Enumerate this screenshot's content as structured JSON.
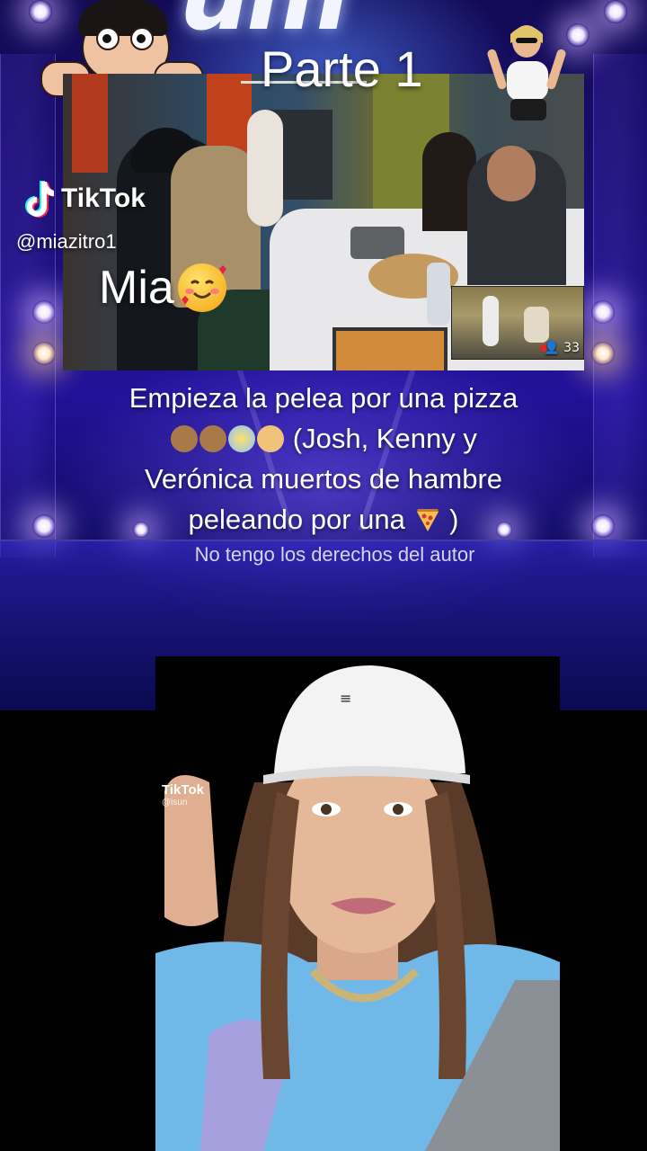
{
  "video": {
    "part_title": "Parte 1",
    "top_logo_partial": "um",
    "viewer_count": "33"
  },
  "watermark": {
    "brand": "TikTok",
    "handle": "@miazitro1",
    "overlay_name": "Mia",
    "overlay_emoji": "smiling-face-with-hearts"
  },
  "caption": {
    "line1": "Empieza la pelea por una pizza",
    "line2_emojis": [
      "see-no-evil-monkey",
      "hear-no-evil-monkey",
      "screaming-face",
      "woman-facepalming"
    ],
    "line2_text": "(Josh, Kenny y",
    "line3": "Verónica muertos de hambre",
    "line4_text": "peleando por una",
    "line4_emoji": "pizza",
    "line4_end": ")"
  },
  "disclaimer": "No tengo los derechos del autor",
  "bottom_watermark": {
    "brand": "TikTok",
    "handle": "@isun"
  },
  "colors": {
    "stage_bg": "#1b0f77",
    "accent_purple": "#7a5cff",
    "text": "#ffffff"
  }
}
